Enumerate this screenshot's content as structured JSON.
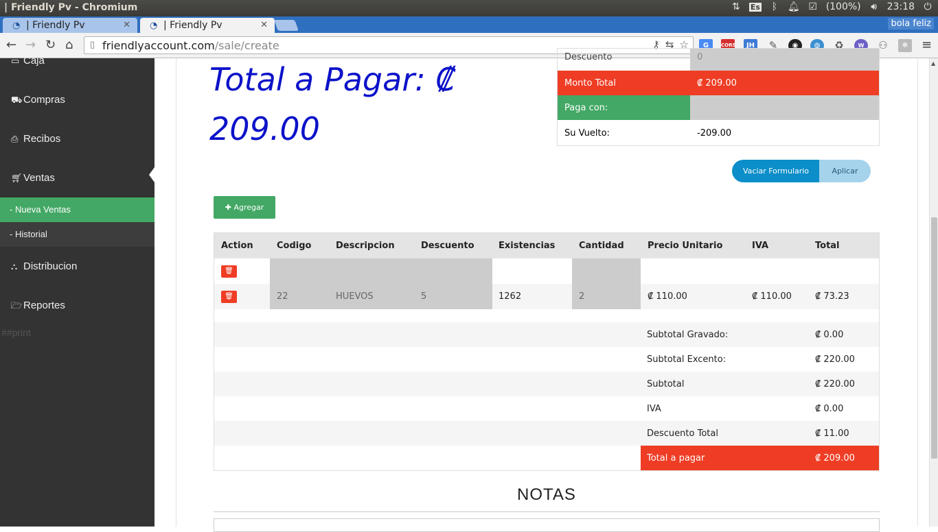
{
  "os": {
    "window_title": "| Friendly Pv - Chromium",
    "keyboard_layout": "Es",
    "battery": "(100%)",
    "clock": "23:18"
  },
  "browser": {
    "tabs": [
      {
        "label": "| Friendly Pv",
        "active": false
      },
      {
        "label": "| Friendly Pv",
        "active": true
      }
    ],
    "profile_name": "bola feliz",
    "url_domain": "friendlyaccount.com",
    "url_path": "/sale/create",
    "extensions": [
      "cors-icon",
      "jh-icon"
    ],
    "ext_labels": {
      "cors": "CORS",
      "jh": "JH"
    }
  },
  "sidebar": {
    "items": [
      {
        "label": "Caja",
        "icon": "cash-icon"
      },
      {
        "label": "Compras",
        "icon": "truck-icon"
      },
      {
        "label": "Recibos",
        "icon": "print-icon"
      },
      {
        "label": "Ventas",
        "icon": "cart-icon"
      },
      {
        "label": "Distribucion",
        "icon": "sitemap-icon"
      },
      {
        "label": "Reportes",
        "icon": "folder-open-icon"
      }
    ],
    "subitems": [
      {
        "label": "- Nueva Ventas",
        "active": true
      },
      {
        "label": "- Historial",
        "active": false
      }
    ],
    "debug_text": "##print"
  },
  "main": {
    "big_total": "Total a Pagar: ₡ 209.00",
    "payment": {
      "descuento_label": "Descuento",
      "descuento_value": "0",
      "monto_label": "Monto Total",
      "monto_value": "₡ 209.00",
      "paga_label": "Paga con:",
      "paga_value": "",
      "vuelto_label": "Su Vuelto:",
      "vuelto_value": "-209.00"
    },
    "buttons": {
      "vaciar": "Vaciar Formulario",
      "aplicar": "Aplicar",
      "agregar": "Agregar"
    },
    "table": {
      "headers": [
        "Action",
        "Codigo",
        "Descripcion",
        "Descuento",
        "Existencias",
        "Cantidad",
        "Precio Unitario",
        "IVA",
        "Total"
      ],
      "rows": [
        {
          "codigo": "",
          "descripcion": "",
          "descuento": "",
          "existencias": "",
          "cantidad": "",
          "precio": "",
          "iva": "",
          "total": ""
        },
        {
          "codigo": "22",
          "descripcion": "HUEVOS",
          "descuento": "5",
          "existencias": "1262",
          "cantidad": "2",
          "precio": "₡ 110.00",
          "iva": "₡ 110.00",
          "total": "₡ 73.23"
        }
      ],
      "summary": [
        {
          "label": "Subtotal Gravado:",
          "value": "₡ 0.00"
        },
        {
          "label": "Subtotal Excento:",
          "value": "₡ 220.00"
        },
        {
          "label": "Subtotal",
          "value": "₡ 220.00"
        },
        {
          "label": "IVA",
          "value": "₡ 0.00"
        },
        {
          "label": "Descuento Total",
          "value": "₡ 11.00"
        },
        {
          "label": "Total a pagar",
          "value": "₡ 209.00"
        }
      ]
    },
    "notas_title": "NOTAS"
  },
  "colors": {
    "accent_red": "#ee3d24",
    "accent_green": "#43a865",
    "accent_blue": "#0b8ec9",
    "total_text": "#0c12c9",
    "sidebar_bg": "#333333"
  }
}
